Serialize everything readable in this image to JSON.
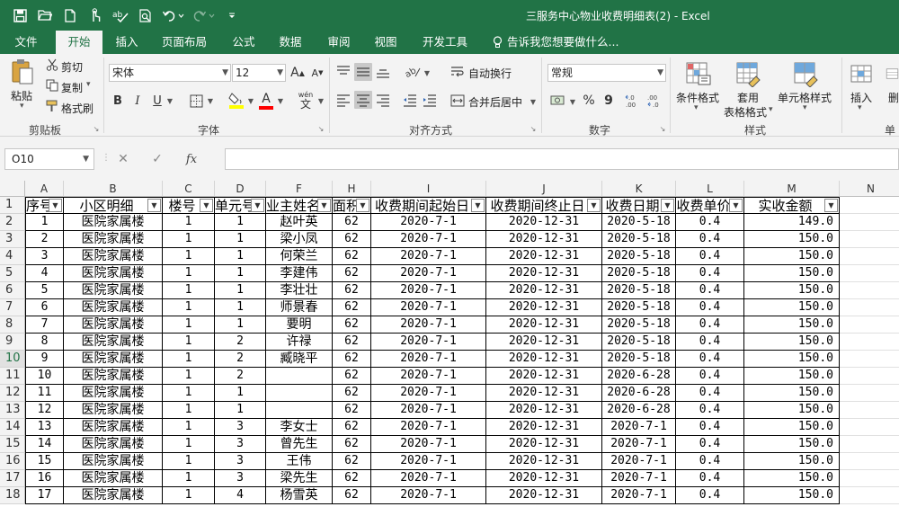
{
  "window": {
    "title": "三服务中心物业收费明细表(2)  -  Excel"
  },
  "qat": {
    "icons": [
      "save-icon",
      "open-icon",
      "new-icon",
      "touch-mode-icon",
      "spelling-icon",
      "print-preview-icon",
      "undo-icon",
      "redo-icon",
      "customize-icon"
    ]
  },
  "tabs": [
    {
      "label": "文件",
      "active": false
    },
    {
      "label": "开始",
      "active": true
    },
    {
      "label": "插入",
      "active": false
    },
    {
      "label": "页面布局",
      "active": false
    },
    {
      "label": "公式",
      "active": false
    },
    {
      "label": "数据",
      "active": false
    },
    {
      "label": "审阅",
      "active": false
    },
    {
      "label": "视图",
      "active": false
    },
    {
      "label": "开发工具",
      "active": false
    },
    {
      "label": "告诉我您想要做什么...",
      "active": false
    }
  ],
  "ribbon": {
    "clipboard": {
      "paste": "粘贴",
      "cut": "剪切",
      "copy": "复制",
      "format_painter": "格式刷",
      "group": "剪贴板"
    },
    "font": {
      "name": "宋体",
      "size": "12",
      "group": "字体",
      "bold": "B",
      "italic": "I",
      "underline": "U",
      "grow": "A",
      "shrink": "A",
      "phonetic": "wén",
      "font_color": "A"
    },
    "alignment": {
      "wrap": "自动换行",
      "merge": "合并后居中",
      "group": "对齐方式"
    },
    "number": {
      "format": "常规",
      "percent": "%",
      "comma": "9",
      "inc_decimal": "←.0\n.00",
      "dec_decimal": ".00\n→.0",
      "group": "数字"
    },
    "styles": {
      "conditional": "条件格式",
      "table_format_1": "套用",
      "table_format_2": "表格格式",
      "cell_styles": "单元格样式",
      "group": "样式"
    },
    "cells": {
      "insert": "插入",
      "delete": "删",
      "group": "单"
    }
  },
  "formula_bar": {
    "name_box": "O10",
    "cancel": "✕",
    "enter": "✓",
    "fx": "fx",
    "formula": ""
  },
  "columns": [
    "A",
    "B",
    "C",
    "D",
    "F",
    "H",
    "I",
    "J",
    "K",
    "L",
    "M",
    "N"
  ],
  "header_row": {
    "row_number": "1",
    "cells": [
      "序号",
      "小区明细",
      "楼号",
      "单元号",
      "业主姓名",
      "面积",
      "收费期间起始日",
      "收费期间终止日",
      "收费日期",
      "收费单价",
      "实收金额"
    ]
  },
  "rows": [
    {
      "row": "2",
      "cells": [
        "1",
        "医院家属楼",
        "1",
        "1",
        "赵叶英",
        "62",
        "2020-7-1",
        "2020-12-31",
        "2020-5-18",
        "0.4",
        "149.0"
      ]
    },
    {
      "row": "3",
      "cells": [
        "2",
        "医院家属楼",
        "1",
        "1",
        "梁小凤",
        "62",
        "2020-7-1",
        "2020-12-31",
        "2020-5-18",
        "0.4",
        "150.0"
      ]
    },
    {
      "row": "4",
      "cells": [
        "3",
        "医院家属楼",
        "1",
        "1",
        "何荣兰",
        "62",
        "2020-7-1",
        "2020-12-31",
        "2020-5-18",
        "0.4",
        "150.0"
      ]
    },
    {
      "row": "5",
      "cells": [
        "4",
        "医院家属楼",
        "1",
        "1",
        "李建伟",
        "62",
        "2020-7-1",
        "2020-12-31",
        "2020-5-18",
        "0.4",
        "150.0"
      ]
    },
    {
      "row": "6",
      "cells": [
        "5",
        "医院家属楼",
        "1",
        "1",
        "李壮壮",
        "62",
        "2020-7-1",
        "2020-12-31",
        "2020-5-18",
        "0.4",
        "150.0"
      ]
    },
    {
      "row": "7",
      "cells": [
        "6",
        "医院家属楼",
        "1",
        "1",
        "师景春",
        "62",
        "2020-7-1",
        "2020-12-31",
        "2020-5-18",
        "0.4",
        "150.0"
      ]
    },
    {
      "row": "8",
      "cells": [
        "7",
        "医院家属楼",
        "1",
        "1",
        "要明",
        "62",
        "2020-7-1",
        "2020-12-31",
        "2020-5-18",
        "0.4",
        "150.0"
      ]
    },
    {
      "row": "9",
      "cells": [
        "8",
        "医院家属楼",
        "1",
        "2",
        "许禄",
        "62",
        "2020-7-1",
        "2020-12-31",
        "2020-5-18",
        "0.4",
        "150.0"
      ]
    },
    {
      "row": "10",
      "cells": [
        "9",
        "医院家属楼",
        "1",
        "2",
        "臧晓平",
        "62",
        "2020-7-1",
        "2020-12-31",
        "2020-5-18",
        "0.4",
        "150.0"
      ]
    },
    {
      "row": "11",
      "cells": [
        "10",
        "医院家属楼",
        "1",
        "2",
        "",
        "62",
        "2020-7-1",
        "2020-12-31",
        "2020-6-28",
        "0.4",
        "150.0"
      ]
    },
    {
      "row": "12",
      "cells": [
        "11",
        "医院家属楼",
        "1",
        "1",
        "",
        "62",
        "2020-7-1",
        "2020-12-31",
        "2020-6-28",
        "0.4",
        "150.0"
      ]
    },
    {
      "row": "13",
      "cells": [
        "12",
        "医院家属楼",
        "1",
        "1",
        "",
        "62",
        "2020-7-1",
        "2020-12-31",
        "2020-6-28",
        "0.4",
        "150.0"
      ]
    },
    {
      "row": "14",
      "cells": [
        "13",
        "医院家属楼",
        "1",
        "3",
        "李女士",
        "62",
        "2020-7-1",
        "2020-12-31",
        "2020-7-1",
        "0.4",
        "150.0"
      ]
    },
    {
      "row": "15",
      "cells": [
        "14",
        "医院家属楼",
        "1",
        "3",
        "曾先生",
        "62",
        "2020-7-1",
        "2020-12-31",
        "2020-7-1",
        "0.4",
        "150.0"
      ]
    },
    {
      "row": "16",
      "cells": [
        "15",
        "医院家属楼",
        "1",
        "3",
        "王伟",
        "62",
        "2020-7-1",
        "2020-12-31",
        "2020-7-1",
        "0.4",
        "150.0"
      ]
    },
    {
      "row": "17",
      "cells": [
        "16",
        "医院家属楼",
        "1",
        "3",
        "梁先生",
        "62",
        "2020-7-1",
        "2020-12-31",
        "2020-7-1",
        "0.4",
        "150.0"
      ]
    },
    {
      "row": "18",
      "cells": [
        "17",
        "医院家属楼",
        "1",
        "4",
        "杨雪英",
        "62",
        "2020-7-1",
        "2020-12-31",
        "2020-7-1",
        "0.4",
        "150.0"
      ]
    }
  ],
  "selected_row": "10",
  "colors": {
    "accent": "#217346",
    "ribbon_bg": "#f3f3f3",
    "grid_border": "#000000"
  }
}
